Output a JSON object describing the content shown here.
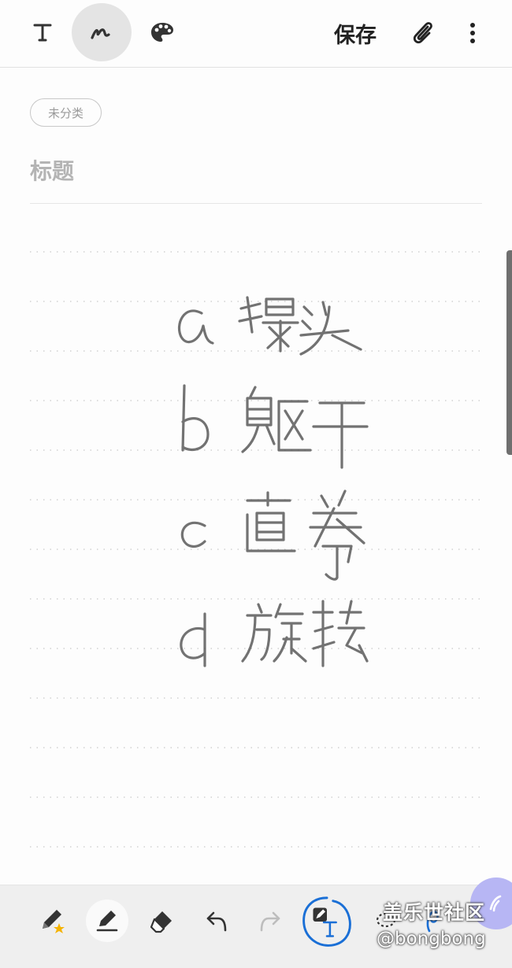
{
  "toolbar": {
    "text_mode_icon": "text-T-icon",
    "pen_mode_icon": "handwriting-pen-icon",
    "palette_icon": "palette-icon",
    "save_label": "保存",
    "attach_icon": "paperclip-icon",
    "more_icon": "more-vertical-icon"
  },
  "note": {
    "category_label": "未分类",
    "title_placeholder": "标题",
    "handwriting_lines": [
      "a 爆头",
      "b 躯干",
      "c 直拳",
      "d 旋转"
    ]
  },
  "bottom_toolbar": {
    "tools": [
      "pen-star-icon",
      "highlighter-icon",
      "eraser-icon",
      "undo-icon",
      "redo-icon",
      "handwriting-to-text-icon",
      "lasso-icon"
    ]
  },
  "watermark": {
    "site": "盖乐世社区",
    "user": "@bongbong"
  },
  "colors": {
    "accent_blue": "#1a6fd6",
    "float_button": "#b7b6f4",
    "ink": "#555555"
  }
}
